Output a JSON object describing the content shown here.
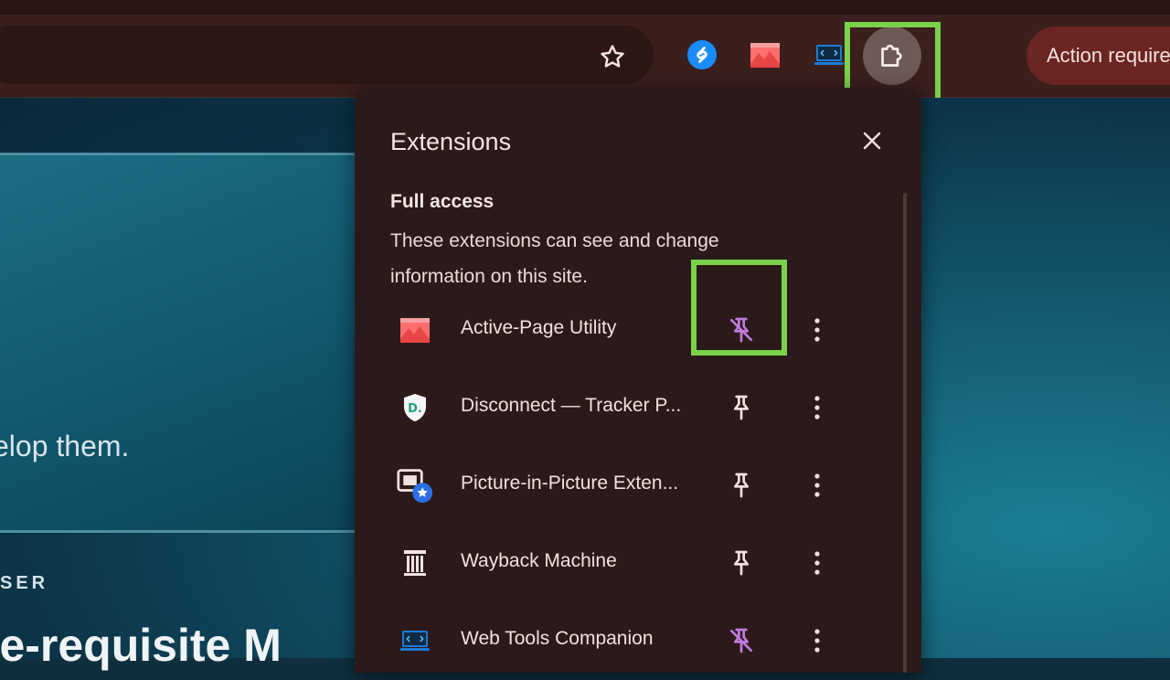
{
  "toolbar": {
    "bookmark_icon": "star-outline-icon",
    "extensions": [
      {
        "name": "shazam",
        "icon": "shazam-icon"
      },
      {
        "name": "active-page-utility",
        "icon": "red-mountain-icon"
      },
      {
        "name": "web-tools-companion",
        "icon": "monitor-code-icon"
      }
    ],
    "extensions_menu_icon": "puzzle-icon",
    "action_pill": "Action required"
  },
  "background": {
    "partial_text": "elop them.",
    "eyebrow": "SER",
    "heading": "re-requisite M"
  },
  "popup": {
    "title": "Extensions",
    "close_icon": "close-icon",
    "section_title": "Full access",
    "section_desc": "These extensions can see and change information on this site.",
    "items": [
      {
        "name": "Active-Page Utility",
        "icon": "active-page-icon",
        "pinned": true
      },
      {
        "name": "Disconnect — Tracker P...",
        "icon": "disconnect-shield-icon",
        "pinned": false
      },
      {
        "name": "Picture-in-Picture Exten...",
        "icon": "pip-icon",
        "pinned": false
      },
      {
        "name": "Wayback Machine",
        "icon": "wayback-pillar-icon",
        "pinned": false
      },
      {
        "name": "Web Tools Companion",
        "icon": "web-tools-icon",
        "pinned": true
      }
    ]
  },
  "colors": {
    "highlight": "#7ad24a",
    "pinned_accent": "#c07be0",
    "chrome_bg": "#3a1f1d",
    "popup_bg": "#2b1a19",
    "action_pill_bg": "#6b2522"
  }
}
